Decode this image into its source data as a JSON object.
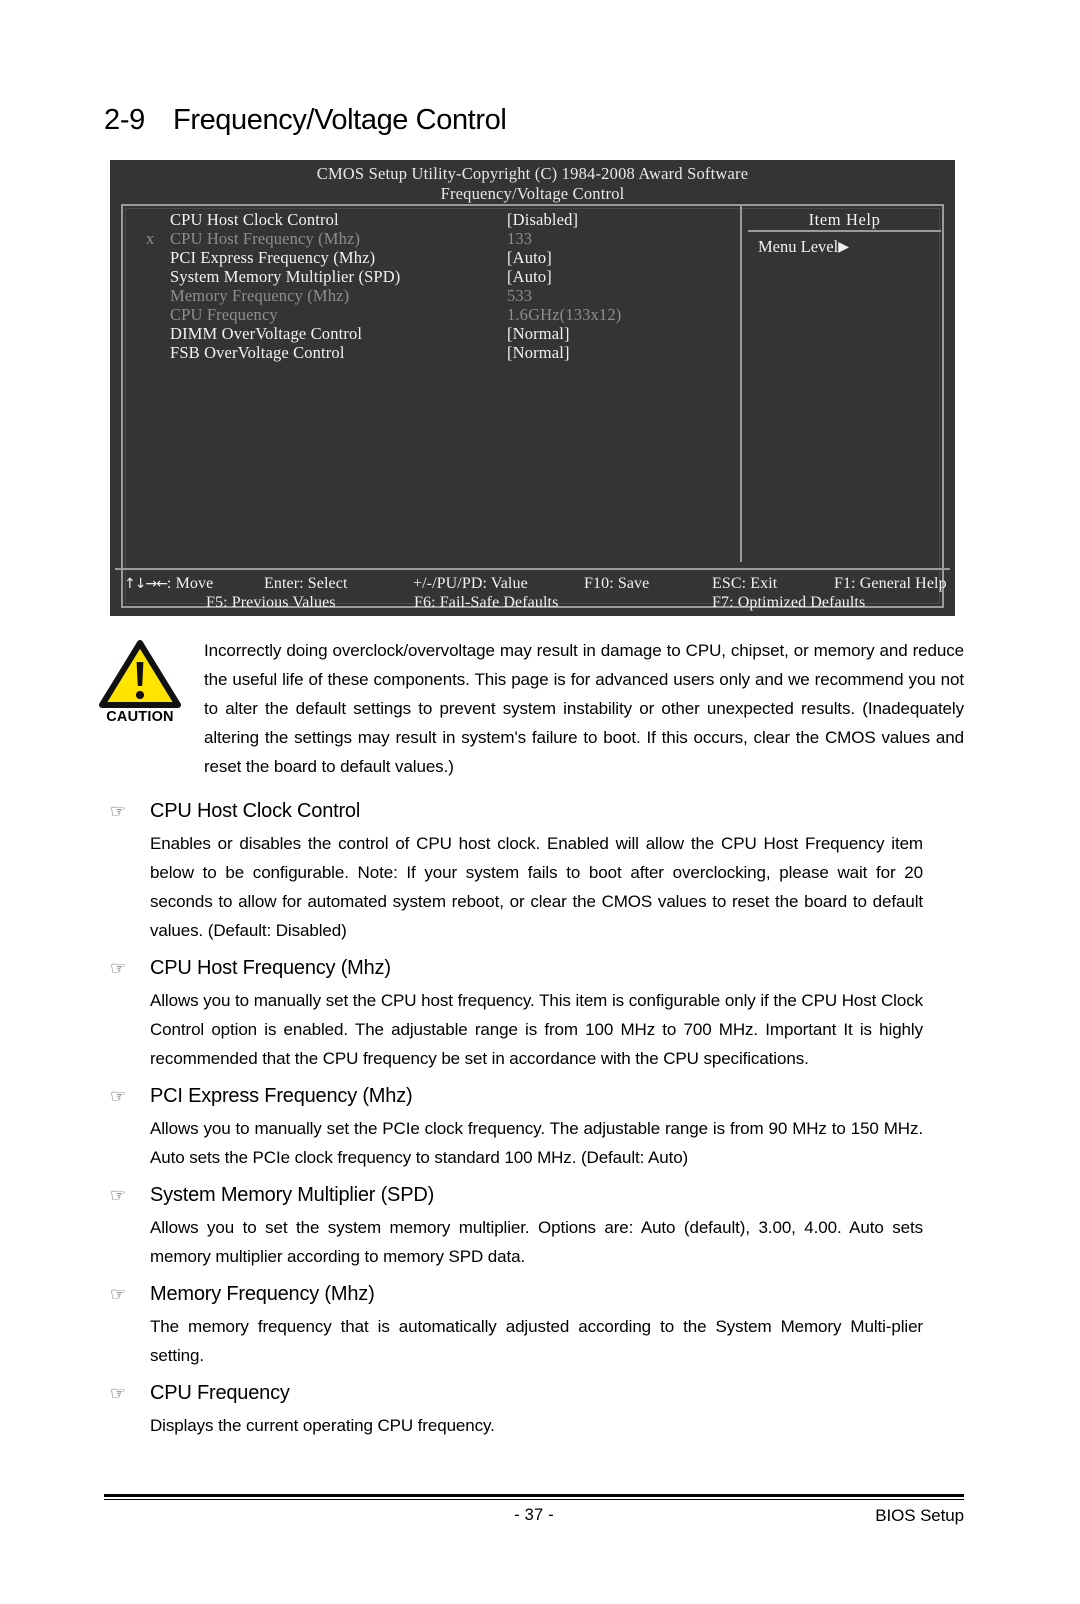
{
  "heading": {
    "number": "2-9",
    "title": "Frequency/Voltage Control"
  },
  "bios": {
    "titlebar": "CMOS Setup Utility-Copyright (C) 1984-2008 Award Software",
    "subtitle": "Frequency/Voltage Control",
    "settings": [
      {
        "prefix": "",
        "label": "CPU Host Clock Control",
        "value": "[Disabled]",
        "dim": false
      },
      {
        "prefix": "x",
        "label": "CPU Host Frequency (Mhz)",
        "value": "133",
        "dim": true
      },
      {
        "prefix": "",
        "label": "PCI Express Frequency (Mhz)",
        "value": "[Auto]",
        "dim": false
      },
      {
        "prefix": "",
        "label": "System Memory Multiplier (SPD)",
        "value": "[Auto]",
        "dim": false
      },
      {
        "prefix": "",
        "label": "Memory Frequency (Mhz)",
        "value": "533",
        "dim": true
      },
      {
        "prefix": "",
        "label": "CPU Frequency",
        "value": "1.6GHz(133x12)",
        "dim": true
      },
      {
        "prefix": "",
        "label": "DIMM OverVoltage Control",
        "value": "[Normal]",
        "dim": false
      },
      {
        "prefix": "",
        "label": "FSB OverVoltage Control",
        "value": "[Normal]",
        "dim": false
      }
    ],
    "item_help": {
      "title": "Item Help",
      "menu_level_label": "Menu Level",
      "menu_level_arrow": "▶"
    },
    "legend": {
      "row1": [
        {
          "key": "↑↓→←",
          "text": ": Move"
        },
        {
          "key": "",
          "text": "Enter: Select"
        },
        {
          "key": "",
          "text": "+/-/PU/PD: Value"
        },
        {
          "key": "",
          "text": "F10: Save"
        },
        {
          "key": "",
          "text": "ESC: Exit"
        },
        {
          "key": "",
          "text": "F1: General Help"
        }
      ],
      "row2": [
        {
          "key": "",
          "text": "F5: Previous Values"
        },
        {
          "key": "",
          "text": "F6: Fail-Safe Defaults"
        },
        {
          "key": "",
          "text": "F7: Optimized Defaults"
        }
      ]
    },
    "colors": {
      "background": "#343434",
      "border": "#9b9b9b",
      "text": "#f2f2f2",
      "dim_text": "#8e8e8e"
    }
  },
  "caution": {
    "word": "CAUTION",
    "icon_color": "#ffe400",
    "text": "Incorrectly doing overclock/overvoltage may result in damage to CPU, chipset, or memory and reduce the useful life of these components.  This page is for advanced users only and we recommend you not to alter the default settings to prevent system instability or other unexpected results. (Inadequately altering the settings may result in system's failure to boot. If this occurs, clear the CMOS values and reset the board to default values.)"
  },
  "sections": [
    {
      "title": "CPU Host Clock Control",
      "body": "Enables or disables the control of CPU host clock. Enabled will allow the CPU Host Frequency item below to be configurable. Note: If your system fails to boot after overclocking, please wait for 20 seconds to allow for automated system reboot, or clear the CMOS values to reset the board to default values. (Default: Disabled)"
    },
    {
      "title": "CPU Host Frequency (Mhz)",
      "body": "Allows you to manually set the CPU host frequency. This item is configurable only if the CPU Host Clock Control option is enabled. The adjustable range is from 100 MHz to 700 MHz. Important It is highly recommended that the CPU frequency be set in accordance with the CPU specifications."
    },
    {
      "title": "PCI Express Frequency (Mhz)",
      "body": "Allows you to manually set the PCIe clock frequency. The adjustable range is from 90 MHz to 150 MHz. Auto sets the PCIe clock frequency to standard 100 MHz. (Default: Auto)"
    },
    {
      "title": "System Memory Multiplier (SPD)",
      "body": "Allows you to set the system memory multiplier. Options are: Auto (default), 3.00, 4.00. Auto sets memory multiplier according to memory SPD data."
    },
    {
      "title": "Memory Frequency (Mhz)",
      "body": "The memory frequency that is automatically adjusted according to the System Memory Multi-plier setting."
    },
    {
      "title": "CPU Frequency",
      "body": "Displays the current operating CPU frequency."
    }
  ],
  "bullet_icon": "☞",
  "footer": {
    "page_number": "- 37 -",
    "right_label": "BIOS Setup"
  }
}
